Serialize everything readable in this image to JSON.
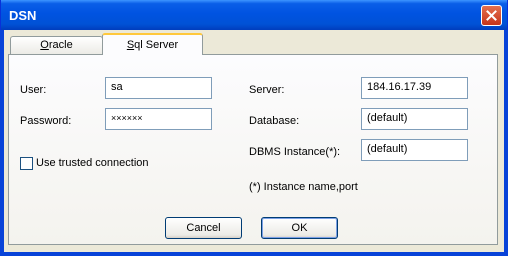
{
  "window": {
    "title": "DSN"
  },
  "tabs": [
    {
      "label": "Oracle",
      "mnemonic": "O",
      "rest": "racle"
    },
    {
      "label": "Sql Server",
      "mnemonic": "S",
      "rest": "ql Server"
    }
  ],
  "form": {
    "user_label": "User:",
    "user_value": "sa",
    "password_label": "Password:",
    "password_value": "××××××",
    "trusted_label": "Use trusted connection",
    "server_label": "Server:",
    "server_value": "184.16.17.39",
    "database_label": "Database:",
    "database_value": "(default)",
    "instance_label": "DBMS Instance(*):",
    "instance_value": "(default)",
    "footnote": "(*) Instance name,port"
  },
  "buttons": {
    "cancel": "Cancel",
    "ok": "OK"
  },
  "colors": {
    "titlebar": "#0054e3",
    "dialog_bg": "#ece9d8",
    "close": "#d54f2e"
  }
}
